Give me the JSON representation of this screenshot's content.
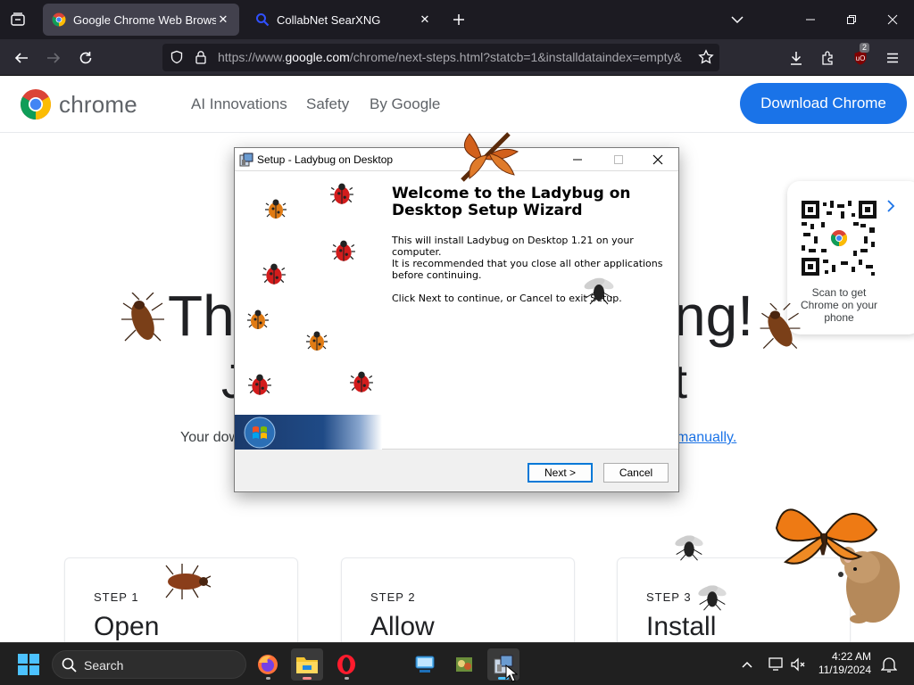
{
  "browser": {
    "tabs": [
      {
        "title": "Google Chrome Web Browser",
        "active": true
      },
      {
        "title": "CollabNet SearXNG",
        "active": false
      }
    ],
    "url_prefix": "https://www.",
    "url_domain": "google.com",
    "url_path": "/chrome/next-steps.html?statcb=1&installdataindex=empty&",
    "extension_badge": "2"
  },
  "site": {
    "logo_text": "chrome",
    "nav": [
      "AI Innovations",
      "Safety",
      "By Google"
    ],
    "download_button": "Download Chrome",
    "hero_left": "Tha",
    "hero_right": "ng!",
    "hero2_left": "J",
    "hero2_right": "t",
    "sub_left": "Your dow",
    "sub_link": "manually.",
    "qr_caption": "Scan to get Chrome on your phone",
    "steps": [
      {
        "label": "STEP 1",
        "title": "Open"
      },
      {
        "label": "STEP 2",
        "title": "Allow"
      },
      {
        "label": "STEP 3",
        "title": "Install"
      }
    ]
  },
  "dialog": {
    "title": "Setup - Ladybug on Desktop",
    "heading": "Welcome to the Ladybug on Desktop Setup Wizard",
    "p1": "This will install Ladybug on Desktop 1.21 on your computer.",
    "p2": "It is recommended that you close all other applications before continuing.",
    "p3": "Click Next to continue, or Cancel to exit Setup.",
    "next": "Next >",
    "cancel": "Cancel"
  },
  "taskbar": {
    "search_placeholder": "Search",
    "time": "4:22 AM",
    "date": "11/19/2024"
  }
}
